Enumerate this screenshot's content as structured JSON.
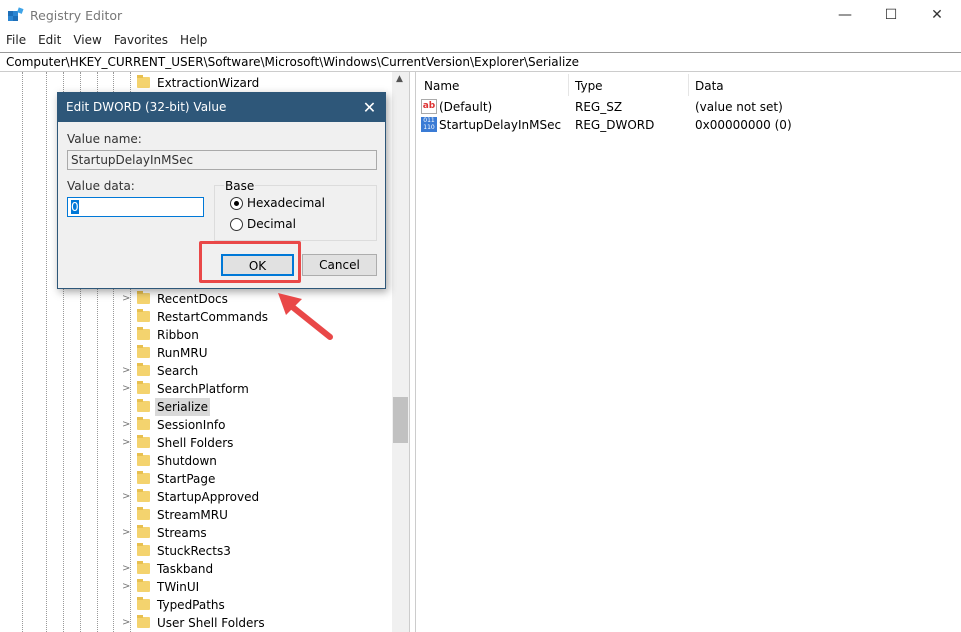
{
  "window": {
    "title": "Registry Editor",
    "minimize": "—",
    "maximize": "☐",
    "close": "✕"
  },
  "menu": [
    "File",
    "Edit",
    "View",
    "Favorites",
    "Help"
  ],
  "address": "Computer\\HKEY_CURRENT_USER\\Software\\Microsoft\\Windows\\CurrentVersion\\Explorer\\Serialize",
  "tree": {
    "top_item": "ExtractionWizard",
    "items": [
      {
        "label": "RecentDocs",
        "expandable": true
      },
      {
        "label": "RestartCommands",
        "expandable": false
      },
      {
        "label": "Ribbon",
        "expandable": false
      },
      {
        "label": "RunMRU",
        "expandable": false
      },
      {
        "label": "Search",
        "expandable": true
      },
      {
        "label": "SearchPlatform",
        "expandable": true
      },
      {
        "label": "Serialize",
        "expandable": false,
        "selected": true
      },
      {
        "label": "SessionInfo",
        "expandable": true
      },
      {
        "label": "Shell Folders",
        "expandable": true
      },
      {
        "label": "Shutdown",
        "expandable": false
      },
      {
        "label": "StartPage",
        "expandable": false
      },
      {
        "label": "StartupApproved",
        "expandable": true
      },
      {
        "label": "StreamMRU",
        "expandable": false
      },
      {
        "label": "Streams",
        "expandable": true
      },
      {
        "label": "StuckRects3",
        "expandable": false
      },
      {
        "label": "Taskband",
        "expandable": true
      },
      {
        "label": "TWinUI",
        "expandable": true
      },
      {
        "label": "TypedPaths",
        "expandable": false
      },
      {
        "label": "User Shell Folders",
        "expandable": true
      }
    ]
  },
  "values": {
    "columns": [
      "Name",
      "Type",
      "Data"
    ],
    "rows": [
      {
        "icon": "string-value-icon",
        "name": "(Default)",
        "type": "REG_SZ",
        "data": "(value not set)"
      },
      {
        "icon": "dword-value-icon",
        "name": "StartupDelayInMSec",
        "type": "REG_DWORD",
        "data": "0x00000000 (0)"
      }
    ]
  },
  "dialog": {
    "title": "Edit DWORD (32-bit) Value",
    "value_name_label": "Value name:",
    "value_name": "StartupDelayInMSec",
    "value_data_label": "Value data:",
    "value_data": "0",
    "base_label": "Base",
    "base_options": [
      {
        "label": "Hexadecimal",
        "selected": true
      },
      {
        "label": "Decimal",
        "selected": false
      }
    ],
    "ok": "OK",
    "cancel": "Cancel",
    "close": "✕"
  },
  "colors": {
    "dialog_title": "#2e5779",
    "highlight": "#e94848",
    "selection": "#d9d9d9"
  }
}
